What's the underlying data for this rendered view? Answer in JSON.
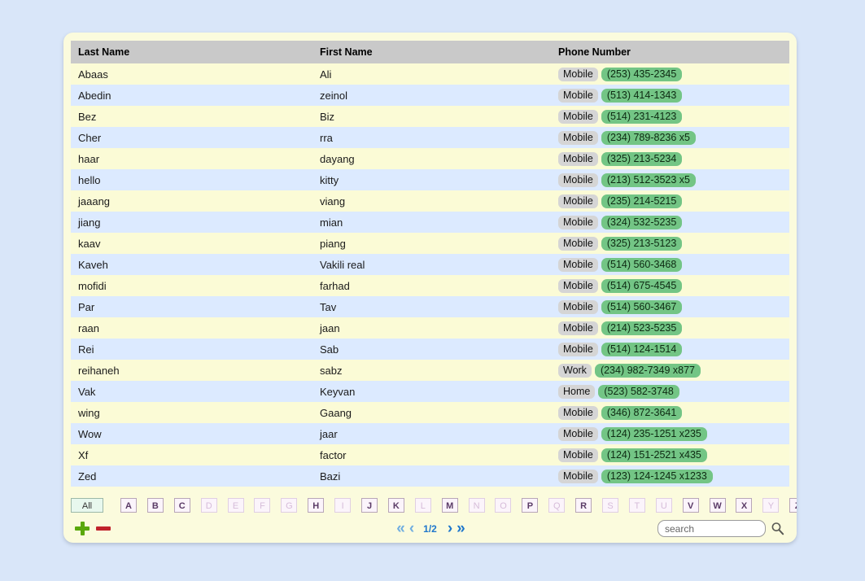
{
  "table": {
    "columns": [
      "Last Name",
      "First Name",
      "Phone Number"
    ],
    "rows": [
      {
        "last": "Abaas",
        "first": "Ali",
        "type": "Mobile",
        "number": "(253) 435-2345"
      },
      {
        "last": "Abedin",
        "first": "zeinol",
        "type": "Mobile",
        "number": "(513) 414-1343"
      },
      {
        "last": "Bez",
        "first": "Biz",
        "type": "Mobile",
        "number": "(514) 231-4123"
      },
      {
        "last": "Cher",
        "first": "rra",
        "type": "Mobile",
        "number": "(234) 789-8236 x5"
      },
      {
        "last": "haar",
        "first": "dayang",
        "type": "Mobile",
        "number": "(325) 213-5234"
      },
      {
        "last": "hello",
        "first": "kitty",
        "type": "Mobile",
        "number": "(213) 512-3523 x5"
      },
      {
        "last": "jaaang",
        "first": "viang",
        "type": "Mobile",
        "number": "(235) 214-5215"
      },
      {
        "last": "jiang",
        "first": "mian",
        "type": "Mobile",
        "number": "(324) 532-5235"
      },
      {
        "last": "kaav",
        "first": "piang",
        "type": "Mobile",
        "number": "(325) 213-5123"
      },
      {
        "last": "Kaveh",
        "first": "Vakili real",
        "type": "Mobile",
        "number": "(514) 560-3468"
      },
      {
        "last": "mofidi",
        "first": "farhad",
        "type": "Mobile",
        "number": "(514) 675-4545"
      },
      {
        "last": "Par",
        "first": "Tav",
        "type": "Mobile",
        "number": "(514) 560-3467"
      },
      {
        "last": "raan",
        "first": "jaan",
        "type": "Mobile",
        "number": "(214) 523-5235"
      },
      {
        "last": "Rei",
        "first": "Sab",
        "type": "Mobile",
        "number": "(514) 124-1514"
      },
      {
        "last": "reihaneh",
        "first": "sabz",
        "type": "Work",
        "number": "(234) 982-7349 x877"
      },
      {
        "last": "Vak",
        "first": "Keyvan",
        "type": "Home",
        "number": "(523) 582-3748"
      },
      {
        "last": "wing",
        "first": "Gaang",
        "type": "Mobile",
        "number": "(346) 872-3641"
      },
      {
        "last": "Wow",
        "first": "jaar",
        "type": "Mobile",
        "number": "(124) 235-1251 x235"
      },
      {
        "last": "Xf",
        "first": "factor",
        "type": "Mobile",
        "number": "(124) 151-2521 x435"
      },
      {
        "last": "Zed",
        "first": "Bazi",
        "type": "Mobile",
        "number": "(123) 124-1245 x1233"
      }
    ]
  },
  "alphabet_filter": {
    "all_label": "All",
    "selected": "All",
    "letters": [
      {
        "label": "A",
        "enabled": true
      },
      {
        "label": "B",
        "enabled": true
      },
      {
        "label": "C",
        "enabled": true
      },
      {
        "label": "D",
        "enabled": false
      },
      {
        "label": "E",
        "enabled": false
      },
      {
        "label": "F",
        "enabled": false
      },
      {
        "label": "G",
        "enabled": false
      },
      {
        "label": "H",
        "enabled": true
      },
      {
        "label": "I",
        "enabled": false
      },
      {
        "label": "J",
        "enabled": true
      },
      {
        "label": "K",
        "enabled": true
      },
      {
        "label": "L",
        "enabled": false
      },
      {
        "label": "M",
        "enabled": true
      },
      {
        "label": "N",
        "enabled": false
      },
      {
        "label": "O",
        "enabled": false
      },
      {
        "label": "P",
        "enabled": true
      },
      {
        "label": "Q",
        "enabled": false
      },
      {
        "label": "R",
        "enabled": true
      },
      {
        "label": "S",
        "enabled": false
      },
      {
        "label": "T",
        "enabled": false
      },
      {
        "label": "U",
        "enabled": false
      },
      {
        "label": "V",
        "enabled": true
      },
      {
        "label": "W",
        "enabled": true
      },
      {
        "label": "X",
        "enabled": true
      },
      {
        "label": "Y",
        "enabled": false
      },
      {
        "label": "Z",
        "enabled": true
      }
    ]
  },
  "footer": {
    "add_icon": "plus-icon",
    "remove_icon": "minus-icon",
    "pager": {
      "first_label": "«",
      "prev_label": "‹",
      "page_indicator": "1/2",
      "next_label": "›",
      "last_label": "»"
    },
    "search": {
      "placeholder": "search",
      "value": "",
      "icon": "magnifier-icon"
    }
  },
  "colors": {
    "page_background": "#d9e6f9",
    "panel_background": "#fbfbdd",
    "header_background": "#c9c9c9",
    "row_odd": "#fbfbd6",
    "row_even": "#dceaff",
    "phone_badge": "#73c585",
    "type_badge": "#d5d5d5",
    "pager_accent": "#1f77cc",
    "add_accent": "#5aa80c",
    "remove_accent": "#c0222b"
  }
}
